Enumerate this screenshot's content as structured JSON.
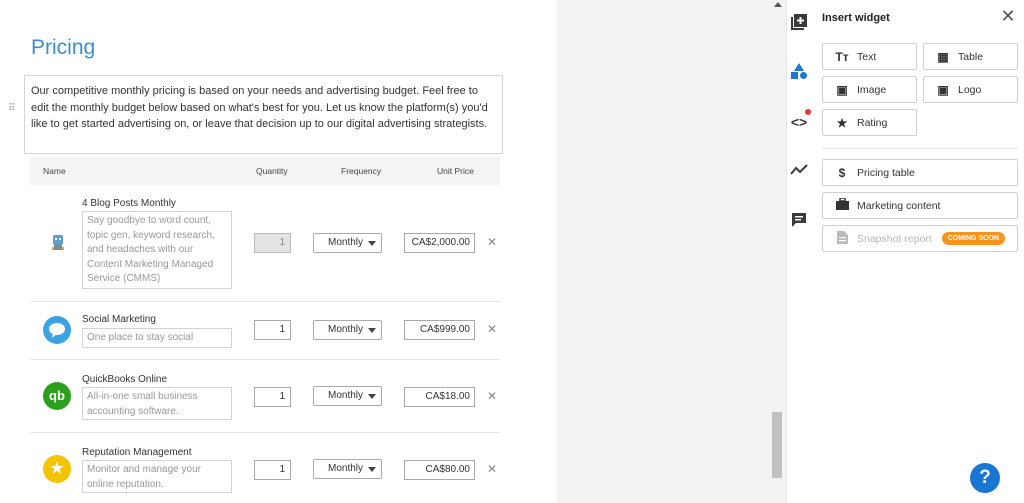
{
  "document": {
    "title": "Pricing",
    "intro": "Our competitive monthly pricing is based on your needs and advertising budget. Feel free to edit the monthly budget below based on what's best for you. Let us know the platform(s) you'd like to get started advertising on, or leave that decision up to our digital advertising strategists.",
    "table": {
      "headers": {
        "name": "Name",
        "quantity": "Quantity",
        "frequency": "Frequency",
        "unit_price": "Unit Price"
      },
      "rows": [
        {
          "name": "4 Blog Posts Monthly",
          "description": "Say goodbye to word count, topic gen, keyword research, and headaches with our Content Marketing Managed Service (CMMS)",
          "quantity": "1",
          "frequency": "Monthly",
          "unit_price": "CA$2,000.00",
          "icon": "robot-icon"
        },
        {
          "name": "Social Marketing",
          "description": "One place to stay social",
          "quantity": "1",
          "frequency": "Monthly",
          "unit_price": "CA$999.00",
          "icon": "chat-bubble-icon",
          "color": "#3aa3e3"
        },
        {
          "name": "QuickBooks Online",
          "description": "All-in-one small business accounting software.",
          "quantity": "1",
          "frequency": "Monthly",
          "unit_price": "CA$18.00",
          "icon": "quickbooks-logo-icon",
          "color": "#2ca01c"
        },
        {
          "name": "Reputation Management",
          "description": "Monitor and manage your online reputation.",
          "quantity": "1",
          "frequency": "Monthly",
          "unit_price": "CA$80.00",
          "icon": "star-icon",
          "color": "#f5c400"
        }
      ]
    }
  },
  "panel": {
    "title": "Insert widget",
    "widgets": {
      "text": "Text",
      "table": "Table",
      "image": "Image",
      "logo": "Logo",
      "rating": "Rating",
      "pricing_table": "Pricing table",
      "marketing_content": "Marketing content",
      "snapshot_report": "Snapshot report",
      "coming_soon": "COMING SOON"
    },
    "help": "?"
  },
  "rail": {
    "icons": [
      "add-block-icon",
      "shapes-icon",
      "code-icon",
      "chart-line-icon",
      "comment-icon"
    ]
  },
  "colors": {
    "accent": "#3b8dd0",
    "badge": "#f7941d",
    "help": "#1976d2"
  }
}
